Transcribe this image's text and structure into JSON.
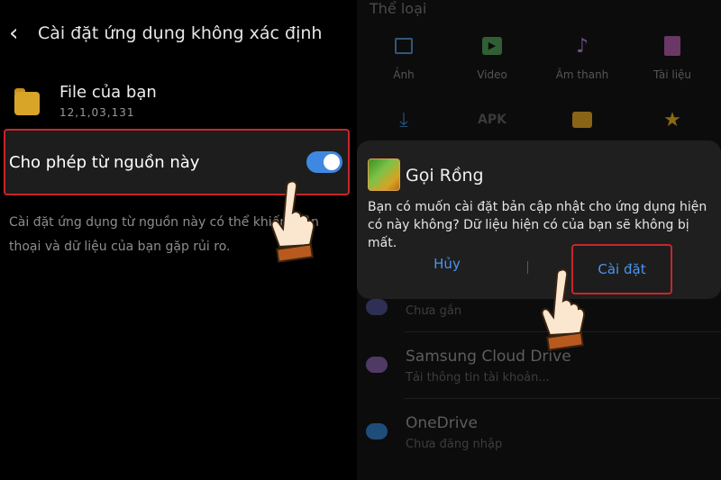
{
  "left": {
    "title": "Cài đặt ứng dụng không xác định",
    "back_icon": "chevron-left-icon",
    "app": {
      "name": "File của bạn",
      "version": "12,1,03,131",
      "icon": "folder-icon"
    },
    "allow": {
      "label": "Cho phép từ nguồn này",
      "toggle_on": true
    },
    "warning": "Cài đặt ứng dụng từ nguồn này có thể khiến điện thoại và dữ liệu của bạn gặp rủi ro."
  },
  "right": {
    "categories_title": "Thể loại",
    "categories": [
      {
        "label": "Ảnh",
        "icon": "image-icon"
      },
      {
        "label": "Video",
        "icon": "video-icon"
      },
      {
        "label": "Âm thanh",
        "icon": "audio-icon"
      },
      {
        "label": "Tài liệu",
        "icon": "document-icon"
      },
      {
        "label": "",
        "icon": "download-icon"
      },
      {
        "label": "APK",
        "icon": "apk-icon"
      },
      {
        "label": "",
        "icon": "folder-icon"
      },
      {
        "label": "",
        "icon": "star-icon"
      }
    ],
    "storage": [
      {
        "title": "",
        "subtitle": "Chưa gắn",
        "icon": "drive-icon"
      },
      {
        "title": "Samsung Cloud Drive",
        "subtitle": "Tải thông tin tài khoản...",
        "icon": "cloud-icon"
      },
      {
        "title": "OneDrive",
        "subtitle": "Chưa đăng nhập",
        "icon": "onedrive-icon"
      }
    ],
    "dialog": {
      "app_name": "Gọi Rồng",
      "message": "Bạn có muốn cài đặt bản cập nhật cho ứng dụng hiện có này không? Dữ liệu hiện có của bạn sẽ không bị mất.",
      "cancel_label": "Hủy",
      "install_label": "Cài đặt"
    }
  },
  "colors": {
    "highlight_border": "#c7262b",
    "toggle_accent": "#3f88e2",
    "button_text": "#4a95ee",
    "dialog_bg": "#1f1f1f"
  }
}
